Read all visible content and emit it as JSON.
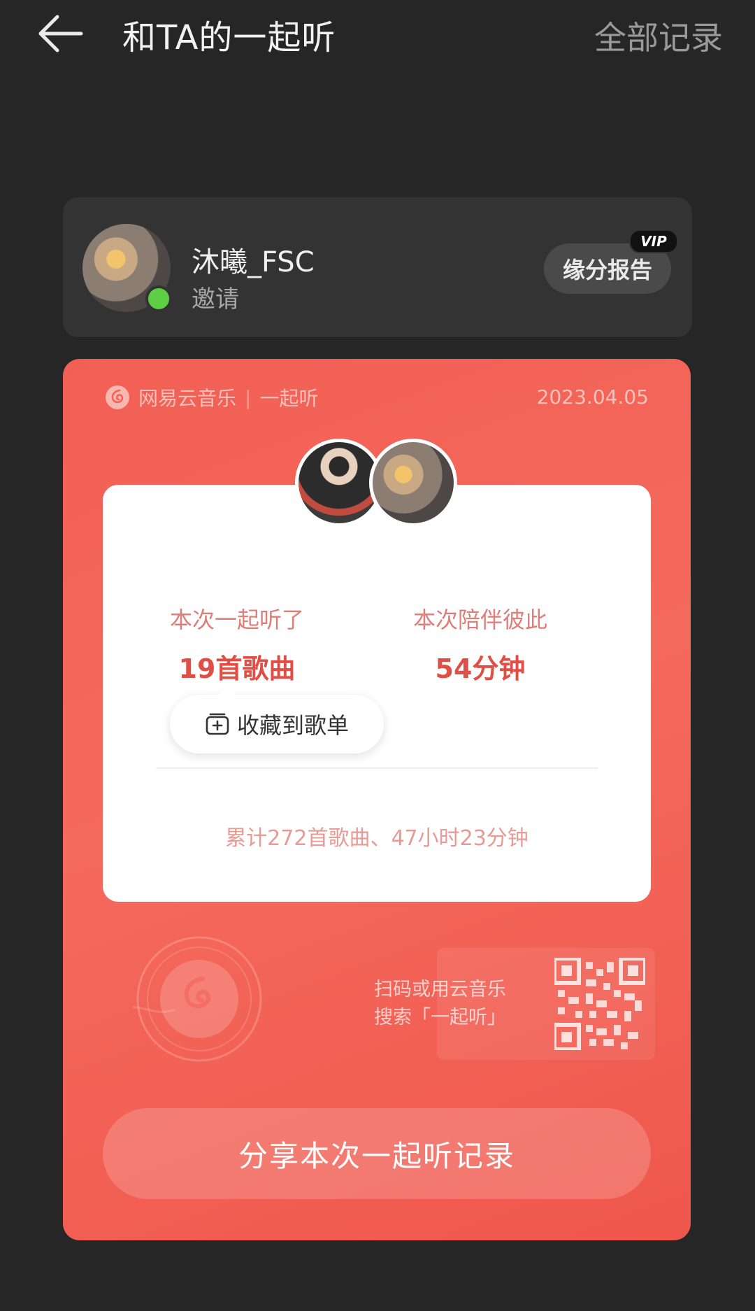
{
  "header": {
    "title": "和TA的一起听",
    "all_records_label": "全部记录"
  },
  "user": {
    "name": "沐曦_FSC",
    "status": "邀请",
    "fate_report_label": "缘分报告",
    "vip_badge": "VIP"
  },
  "share_card": {
    "brand": "网易云音乐",
    "feature": "一起听",
    "date": "2023.04.05",
    "stats": {
      "listened_label": "本次一起听了",
      "listened_value": "19首歌曲",
      "companion_label": "本次陪伴彼此",
      "companion_value": "54分钟"
    },
    "collect_label": "收藏到歌单",
    "total_text": "累计272首歌曲、47小时23分钟",
    "qr_text_line1": "扫码或用云音乐",
    "qr_text_line2": "搜索「一起听」",
    "share_button_label": "分享本次一起听记录"
  },
  "colors": {
    "background": "#262626",
    "card_bg": "#333333",
    "accent_red": "#f25f55",
    "online": "#5ccf45"
  }
}
